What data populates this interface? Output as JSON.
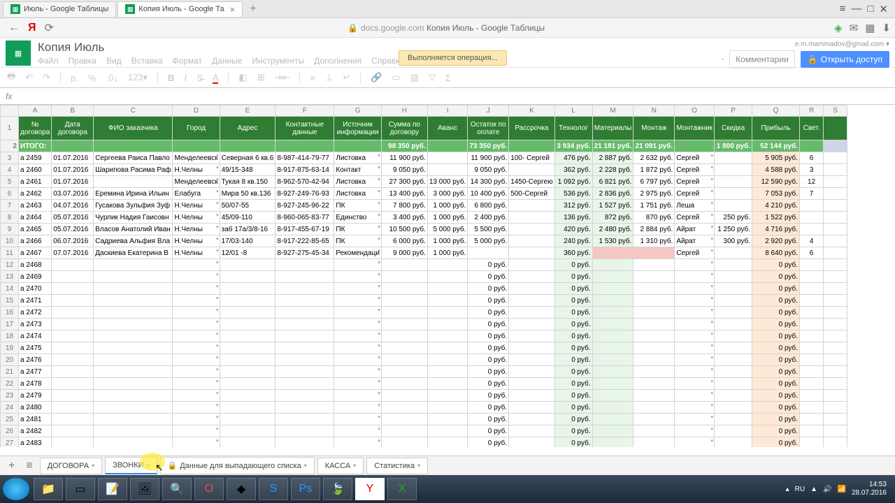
{
  "browser": {
    "tabs": [
      {
        "title": "Июль - Google Таблицы",
        "active": false
      },
      {
        "title": "Копия Июль - Google Та",
        "active": true
      }
    ],
    "url_host": "docs.google.com",
    "url_title": "Копия Июль - Google Таблицы"
  },
  "doc": {
    "title": "Копия Июль",
    "menus": [
      "Файл",
      "Правка",
      "Вид",
      "Вставка",
      "Формат",
      "Данные",
      "Инструменты",
      "Дополнения",
      "Справка"
    ],
    "status": "Выполняется операция...",
    "user": "e.m.mammadov@gmail.com",
    "comments": "Комментарии",
    "share": "Открыть доступ"
  },
  "columns": [
    "A",
    "B",
    "C",
    "D",
    "E",
    "F",
    "G",
    "H",
    "I",
    "J",
    "K",
    "L",
    "M",
    "N",
    "O",
    "P",
    "Q",
    "R",
    "S"
  ],
  "headers": [
    "№ договора",
    "Дата договора",
    "ФИО заказчика",
    "Город",
    "Адрес",
    "Контактные данные",
    "Источник информации",
    "Сумма по договору",
    "Аванс",
    "Остаток по оплате",
    "Рассрочка",
    "Технолог",
    "Материалы",
    "Монтаж",
    "Монтажник",
    "Скидка",
    "Прибыль",
    "Свет.",
    ""
  ],
  "itogo": {
    "label": "ИТОГО:",
    "H": "98 350 руб.",
    "J": "73 350 руб.",
    "L": "3 934 руб.",
    "M": "21 181 руб.",
    "N": "21 091 руб.",
    "P": "1 800 руб.",
    "Q": "52 144 руб."
  },
  "rows": [
    {
      "n": 3,
      "A": "а 2459",
      "B": "01.07.2016",
      "C": "Сергеева Раиса Павло",
      "D": "Менделеевск",
      "E": "Северная 6 кв.6",
      "F": "8-987-414-79-77",
      "G": "Листовка",
      "H": "11 900 руб.",
      "I": "",
      "J": "11 900 руб.",
      "K": "100- Сергей",
      "L": "476 руб.",
      "M": "2 887 руб.",
      "N": "2 632 руб.",
      "O": "Сергей",
      "P": "",
      "Q": "5 905 руб.",
      "R": "6"
    },
    {
      "n": 4,
      "A": "а 2460",
      "B": "01.07.2016",
      "C": "Шарипова Расима Раф",
      "D": "Н.Челны",
      "E": "49/15-348",
      "F": "8-917-875-63-14",
      "G": "Контакт",
      "H": "9 050 руб.",
      "I": "",
      "J": "9 050 руб.",
      "K": "",
      "L": "362 руб.",
      "M": "2 228 руб.",
      "N": "1 872 руб.",
      "O": "Сергей",
      "P": "",
      "Q": "4 588 руб.",
      "R": "3"
    },
    {
      "n": 5,
      "A": "а 2461",
      "B": "01.07.2016",
      "C": "",
      "D": "Менделеевск",
      "E": "Тукая 8 кв.150",
      "F": "8-962-570-42-94",
      "G": "Листовка",
      "H": "27 300 руб.",
      "I": "13 000 руб.",
      "J": "14 300 руб.",
      "K": "1450-Сергею",
      "L": "1 092 руб.",
      "M": "6 821 руб.",
      "N": "6 797 руб.",
      "O": "Сергей",
      "P": "",
      "Q": "12 590 руб.",
      "R": "12"
    },
    {
      "n": 6,
      "A": "а 2462",
      "B": "03.07.2016",
      "C": "Еремина Ирина Ильин",
      "D": "Елабуга",
      "E": "Мира 50 кв.136",
      "F": "8-927-249-76-93",
      "G": "Листовка",
      "H": "13 400 руб.",
      "I": "3 000 руб.",
      "J": "10 400 руб.",
      "K": "500-Сергей",
      "L": "536 руб.",
      "M": "2 836 руб.",
      "N": "2 975 руб.",
      "O": "Сергей",
      "P": "",
      "Q": "7 053 руб.",
      "R": "7"
    },
    {
      "n": 7,
      "A": "а 2463",
      "B": "04.07.2016",
      "C": "Гусакова Зульфия Зуф",
      "D": "Н.Челны",
      "E": "50/07-55",
      "F": "8-927-245-96-22",
      "G": "ПК",
      "H": "7 800 руб.",
      "I": "1 000 руб.",
      "J": "6 800 руб.",
      "K": "",
      "L": "312 руб.",
      "M": "1 527 руб.",
      "N": "1 751 руб.",
      "O": "Леша",
      "P": "",
      "Q": "4 210 руб.",
      "R": ""
    },
    {
      "n": 8,
      "A": "а 2464",
      "B": "05.07.2016",
      "C": "Чурлик Надия Гаисовн",
      "D": "Н.Челны",
      "E": "45/09-110",
      "F": "8-960-065-83-77",
      "G": "Единство",
      "H": "3 400 руб.",
      "I": "1 000 руб.",
      "J": "2 400 руб.",
      "K": "",
      "L": "136 руб.",
      "M": "872 руб.",
      "N": "870 руб.",
      "O": "Сергей",
      "P": "250 руб.",
      "Q": "1 522 руб.",
      "R": ""
    },
    {
      "n": 9,
      "A": "а 2465",
      "B": "05.07.2016",
      "C": "Власов Анатолий Иван",
      "D": "Н.Челны",
      "E": "заб 17а/3/8-16",
      "F": "8-917-455-67-19",
      "G": "ПК",
      "H": "10 500 руб.",
      "I": "5 000 руб.",
      "J": "5 500 руб.",
      "K": "",
      "L": "420 руб.",
      "M": "2 480 руб.",
      "N": "2 884 руб.",
      "O": "Айрат",
      "P": "1 250 руб.",
      "Q": "4 716 руб.",
      "R": ""
    },
    {
      "n": 10,
      "A": "а 2466",
      "B": "06.07.2016",
      "C": "Садриева Альфия Вла",
      "D": "Н.Челны",
      "E": "17/03-140",
      "F": "8-917-222-85-65",
      "G": "ПК",
      "H": "6 000 руб.",
      "I": "1 000 руб.",
      "J": "5 000 руб.",
      "K": "",
      "L": "240 руб.",
      "M": "1 530 руб.",
      "N": "1 310 руб.",
      "O": "Айрат",
      "P": "300 руб.",
      "Q": "2 920 руб.",
      "R": "4"
    },
    {
      "n": 11,
      "A": "а 2467",
      "B": "07.07.2016",
      "C": "Даскиева Екатерина В",
      "D": "Н.Челны",
      "E": "12/01 -8",
      "F": "8-927-275-45-34",
      "G": "Рекомендаци",
      "H": "9 000 руб.",
      "I": "1 000 руб.",
      "J": "",
      "K": "",
      "L": "360 руб.",
      "M": "",
      "N": "",
      "O": "Сергей",
      "P": "",
      "Q": "8 640 руб.",
      "R": "6",
      "redM": true
    }
  ],
  "empty_rows": [
    {
      "n": 12,
      "A": "а 2468"
    },
    {
      "n": 13,
      "A": "а 2469"
    },
    {
      "n": 14,
      "A": "а 2470"
    },
    {
      "n": 15,
      "A": "а 2471"
    },
    {
      "n": 16,
      "A": "а 2472"
    },
    {
      "n": 17,
      "A": "а 2473"
    },
    {
      "n": 18,
      "A": "а 2474"
    },
    {
      "n": 19,
      "A": "а 2475"
    },
    {
      "n": 20,
      "A": "а 2476"
    },
    {
      "n": 21,
      "A": "а 2477"
    },
    {
      "n": 22,
      "A": "а 2478"
    },
    {
      "n": 23,
      "A": "а 2479"
    },
    {
      "n": 24,
      "A": "а 2480"
    },
    {
      "n": 25,
      "A": "а 2481"
    },
    {
      "n": 26,
      "A": "а 2482"
    },
    {
      "n": 27,
      "A": "а 2483"
    }
  ],
  "sheet_tabs": [
    "ДОГОВОРА",
    "ЗВОНКИ",
    "Данные для выпадающего списка",
    "КАССА",
    "Статистика"
  ],
  "taskbar": {
    "time": "14:53",
    "date": "28.07.2016",
    "lang": "RU"
  }
}
